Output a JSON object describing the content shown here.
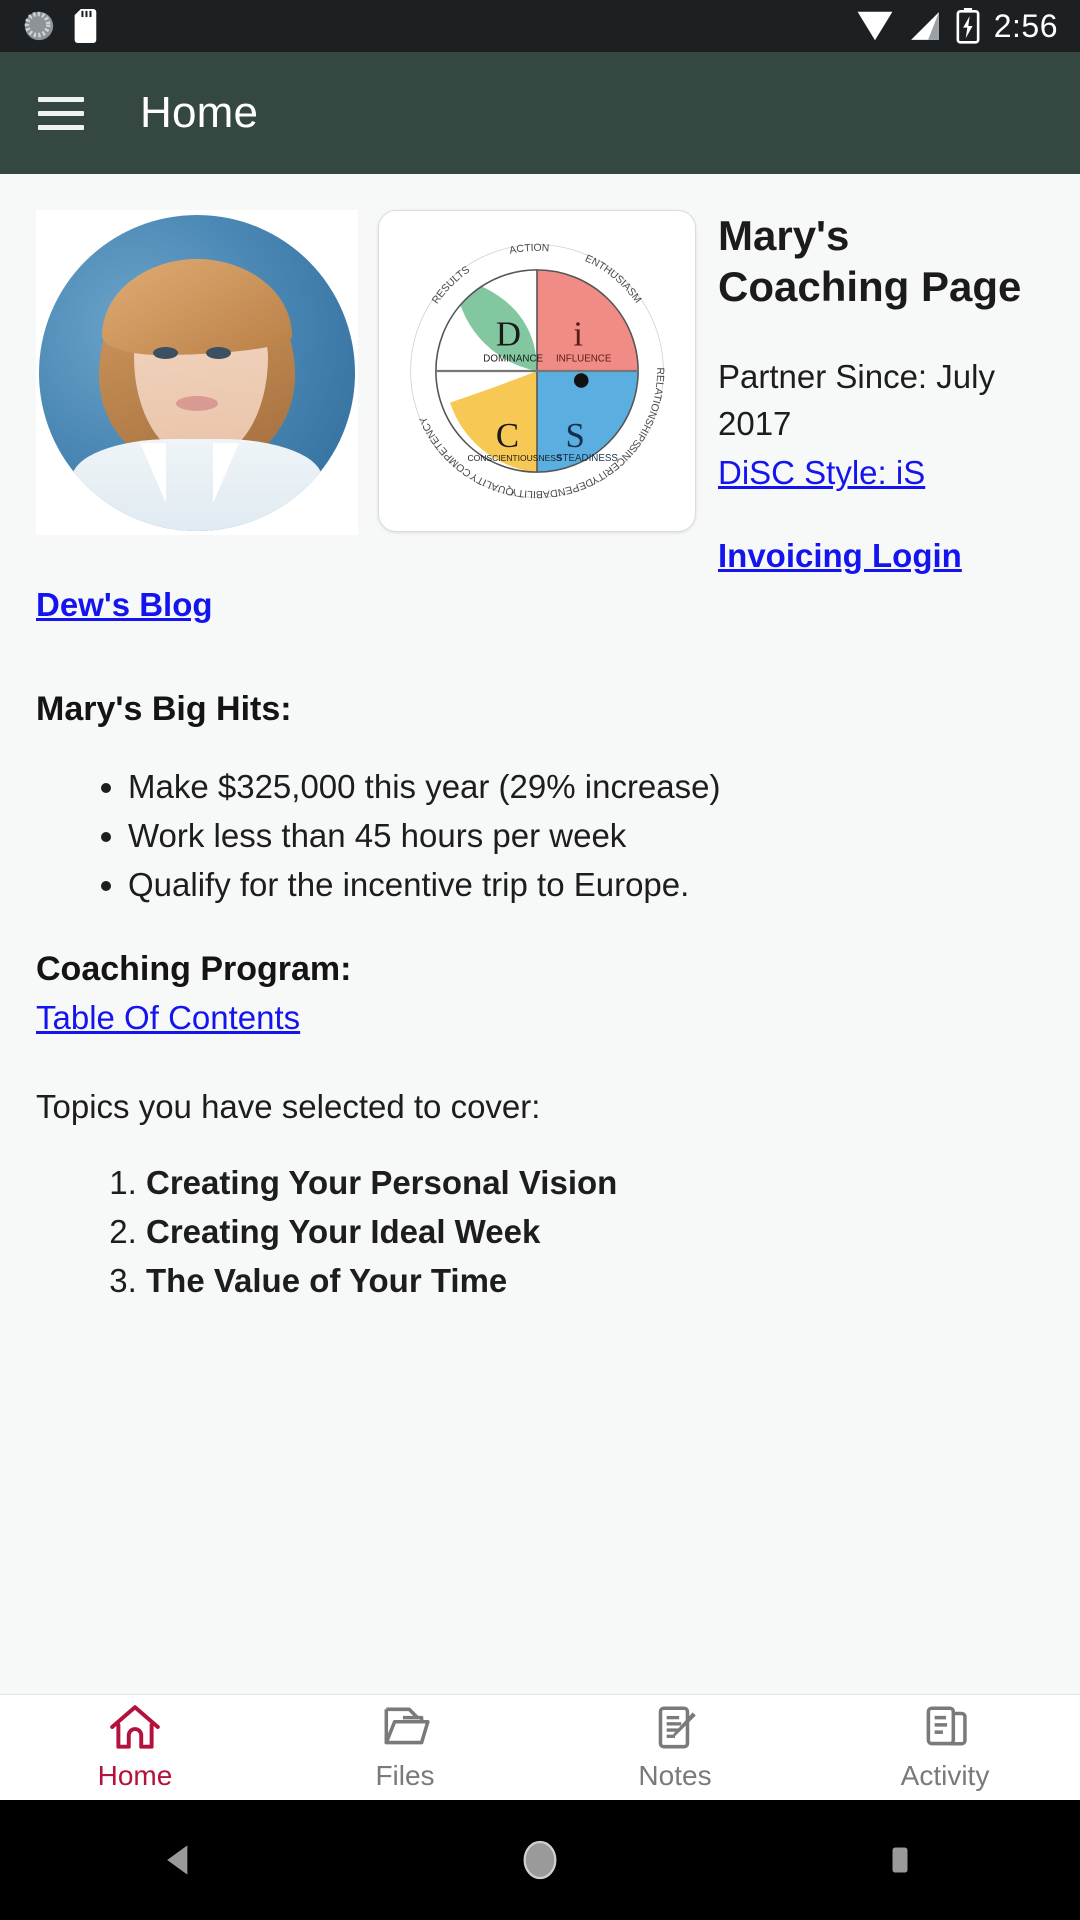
{
  "status_bar": {
    "time": "2:56",
    "icons": [
      "sync-progress-icon",
      "sd-card-icon",
      "wifi-icon",
      "cell-signal-icon",
      "battery-charging-icon"
    ]
  },
  "app_bar": {
    "menu_icon": "hamburger-menu-icon",
    "title": "Home"
  },
  "main": {
    "avatar_alt": "profile-photo",
    "disc_wheel": {
      "alt": "disc-wheel-diagram",
      "quadrants": [
        {
          "letter": "D",
          "word": "DOMINANCE",
          "color": "#7bc49a"
        },
        {
          "letter": "i",
          "word": "INFLUENCE",
          "color": "#f08b85"
        },
        {
          "letter": "S",
          "word": "STEADINESS",
          "color": "#5aafe0"
        },
        {
          "letter": "C",
          "word": "CONSCIENTIOUSNESS",
          "color": "#f7c54b"
        }
      ],
      "outer_labels": [
        "ACTION",
        "ENTHUSIASM",
        "RELATIONSHIPS",
        "SINCERITY",
        "DEPENDABILITY",
        "QUALITY",
        "COMPETENCY",
        "RESULTS"
      ]
    },
    "heading": "Mary's Coaching Page",
    "partner_since": "Partner Since: July 2017",
    "disc_style_link": "DiSC Style: iS",
    "invoicing_link": "Invoicing Login",
    "blog_link": "Dew's Blog",
    "big_hits_heading": "Mary's Big Hits:",
    "big_hits": [
      "Make $325,000 this year (29% increase)",
      "Work less than 45 hours per week",
      "Qualify for the incentive trip to Europe."
    ],
    "coaching_program_heading": "Coaching Program:",
    "toc_link": "Table Of Contents",
    "topics_intro": "Topics you have selected to cover:",
    "topics": [
      "Creating Your Personal Vision",
      "Creating Your Ideal Week",
      "The Value of Your Time"
    ]
  },
  "tab_bar": {
    "active_color": "#b4113c",
    "inactive_color": "#7a7a7a",
    "tabs": [
      {
        "label": "Home",
        "icon": "home-icon",
        "active": true
      },
      {
        "label": "Files",
        "icon": "folder-icon",
        "active": false
      },
      {
        "label": "Notes",
        "icon": "note-pen-icon",
        "active": false
      },
      {
        "label": "Activity",
        "icon": "documents-icon",
        "active": false
      }
    ]
  },
  "nav_bar": {
    "buttons": [
      {
        "name": "back-button",
        "icon": "triangle-left-icon"
      },
      {
        "name": "home-button",
        "icon": "circle-icon"
      },
      {
        "name": "recents-button",
        "icon": "square-icon"
      }
    ]
  }
}
